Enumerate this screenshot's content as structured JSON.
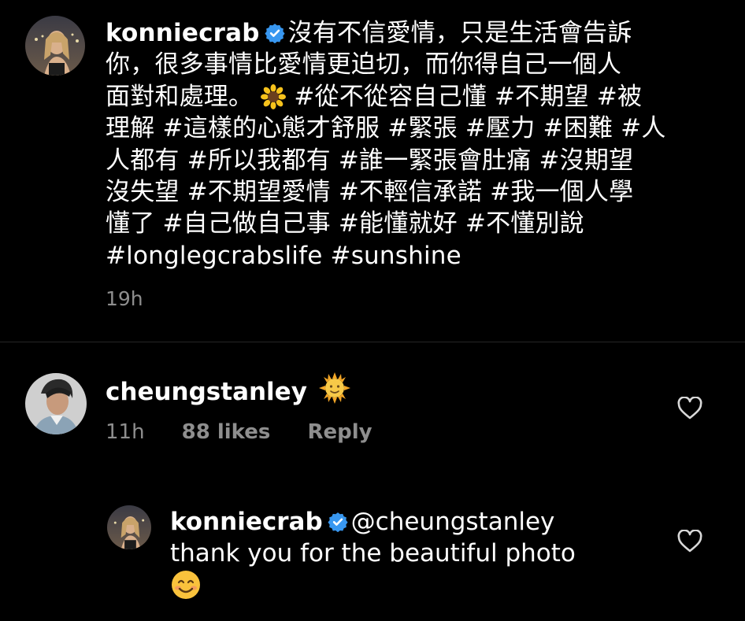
{
  "post": {
    "username": "konniecrab",
    "caption_lines": [
      "沒有不信愛情，只是生活會告訴",
      "你，很多事情比愛情更迫切，而你得自己一個人",
      "面對和處理。",
      "#從不從容自己懂 #不期望 #被",
      "理解 #這樣的心態才舒服 #緊張 #壓力 #困難 #人",
      "人都有 #所以我都有 #誰一緊張會肚痛 #沒期望",
      "沒失望 #不期望愛情 #不輕信承諾 #我一個人學",
      "懂了 #自己做自己事 #能懂就好 #不懂別說",
      "#longlegcrabslife #sunshine"
    ],
    "emoji_icon": "sunflower-emoji",
    "time": "19h"
  },
  "comment": {
    "username": "cheungstanley",
    "emoji_icon": "sun-with-face-emoji",
    "time": "11h",
    "likes": "88 likes",
    "reply_label": "Reply"
  },
  "reply": {
    "username": "konniecrab",
    "mention": "@cheungstanley",
    "text": "thank you for the beautiful photo",
    "emoji_icon": "smiling-face-emoji"
  },
  "colors": {
    "background": "#000000",
    "text": "#ffffff",
    "muted": "#8e8e8e",
    "verified": "#3897f0"
  }
}
